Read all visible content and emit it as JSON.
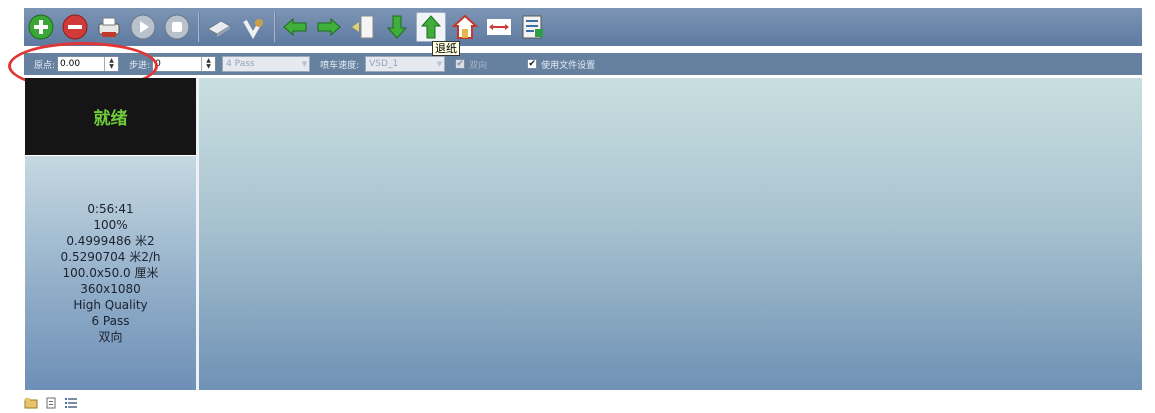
{
  "toolbar": {
    "buttons": [
      {
        "name": "add-icon",
        "color": "#3aa635"
      },
      {
        "name": "remove-icon",
        "color": "#d23a3a"
      },
      {
        "name": "print-icon",
        "color": "#c0392b"
      },
      {
        "name": "play-icon",
        "color": "#b9c1cc"
      },
      {
        "name": "stop-icon",
        "color": "#b9c1cc"
      },
      {
        "name": "cartridge-icon",
        "color": "#9aa3b0"
      },
      {
        "name": "clean-icon",
        "color": "#c9a04a"
      },
      {
        "name": "move-left-icon",
        "color": "#3fae3a"
      },
      {
        "name": "move-right-icon",
        "color": "#3fae3a"
      },
      {
        "name": "feed-edge-icon",
        "color": "#e2d06a"
      },
      {
        "name": "feed-down-icon",
        "color": "#3fae3a"
      },
      {
        "name": "feed-up-icon",
        "color": "#3fae3a"
      },
      {
        "name": "home-icon",
        "color": "#c0392b"
      },
      {
        "name": "width-measure-icon",
        "color": "#d23a3a"
      },
      {
        "name": "report-icon",
        "color": "#3a6ea5"
      }
    ],
    "tooltip": "退纸"
  },
  "settings": {
    "origin_label": "原点:",
    "origin_value": "0.00",
    "step_label": "步进:",
    "step_value": "0",
    "pass_value": "4 Pass",
    "speed_label": "喷车速度:",
    "speed_value": "VSD_1",
    "bidirectional_label": "双向",
    "bidirectional_checked": "✔",
    "use_file_settings_label": "使用文件设置",
    "use_file_settings_checked": "✔",
    "spin_up": "▲",
    "spin_down": "▼",
    "dropdown": "▼"
  },
  "status": {
    "state": "就绪",
    "time": "0:56:41",
    "progress": "100%",
    "area": "0.4999486 米2",
    "rate": "0.5290704 米2/h",
    "size": "100.0x50.0 厘米",
    "resolution": "360x1080",
    "quality": "High Quality",
    "passes": "6 Pass",
    "direction": "双向"
  },
  "colors": {
    "toolbar_bg": "#6c86aa",
    "status_ready": "#6ecc3c",
    "highlight": "#e23535"
  }
}
